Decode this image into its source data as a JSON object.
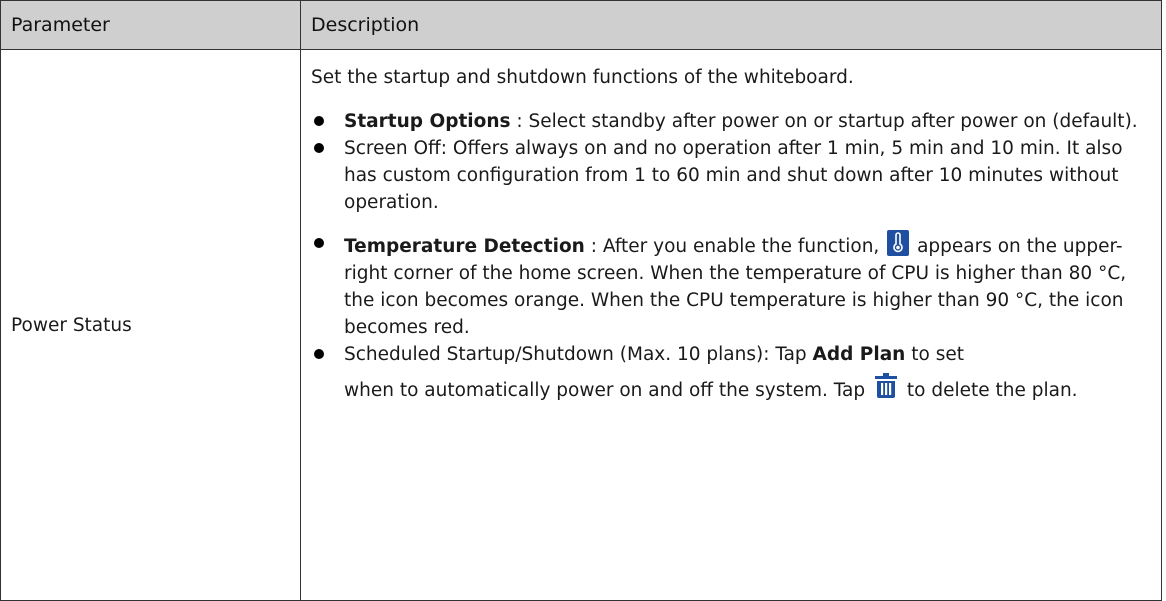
{
  "table": {
    "headers": [
      "Parameter",
      "Description"
    ],
    "row": {
      "parameter": "Power Status",
      "intro": "Set the startup and shutdown functions of the whiteboard.",
      "bullets": [
        {
          "bold": "Startup Options",
          "text": " : Select standby after power on or startup after power on (default)."
        },
        {
          "text": "Screen Off: Offers always on and no operation after 1 min, 5 min and 10 min. It also has custom configuration from 1 to 60 min and shut down after 10 minutes without operation."
        },
        {
          "bold": "Temperature Detection",
          "text_before_icon": " : After you enable the function, ",
          "icon": "thermometer-icon",
          "text_after_icon": " appears on the upper-right corner of the home screen. When the temperature of CPU is higher than 80 °C, the icon becomes orange. When the CPU temperature is higher than 90 °C, the icon becomes red."
        },
        {
          "text_before_bold": "Scheduled Startup/Shutdown (Max. 10 plans): Tap ",
          "bold": "Add Plan",
          "text_after_bold": "  to set",
          "text_line2_before_icon": "when to automatically power on and off the system. Tap ",
          "icon": "trash-icon",
          "text_line2_after_icon": " to delete the plan."
        }
      ]
    }
  },
  "colors": {
    "header_bg": "#cfcfcf",
    "border": "#333333",
    "icon_blue": "#1f4fa0"
  }
}
